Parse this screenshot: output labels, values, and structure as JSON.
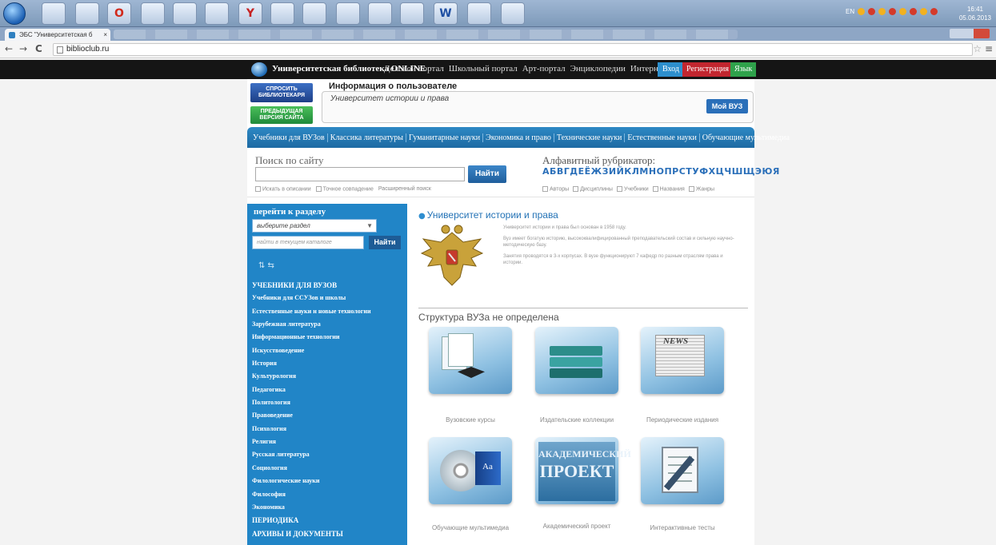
{
  "taskbar": {
    "icons": [
      "W",
      "O",
      "Y",
      "W"
    ],
    "tray_lang": "EN",
    "clock_time": "16:41",
    "clock_date": "05.06.2013"
  },
  "browser": {
    "tab_title": "ЭБС \"Университетская б",
    "tab_close": "×",
    "url": "biblioclub.ru",
    "back": "←",
    "forward": "→",
    "reload": "C",
    "star": "☆",
    "menu": "≡"
  },
  "site": {
    "title": "Университетская библиотека ONLINE",
    "top_nav": [
      "Деловой портал",
      "Школьный портал",
      "Арт-портал",
      "Энциклопедии",
      "Интернет-магазин"
    ],
    "login": "Вход",
    "register": "Регистрация",
    "lang": "Язык"
  },
  "header": {
    "ask_line1": "СПРОСИТЬ",
    "ask_line2": "БИБЛИОТЕКАРЯ",
    "prev_line1": "ПРЕДЫДУЩАЯ",
    "prev_line2": "ВЕРСИЯ САЙТА",
    "userinfo_title": "Информация о пользователе",
    "userinfo_name": "Университет истории и права",
    "myvuz": "Мой ВУЗ"
  },
  "categories": [
    "Учебники для ВУЗов",
    "Классика литературы",
    "Гуманитарные науки",
    "Экономика и право",
    "Технические науки",
    "Естественные науки",
    "Обучающие мультимедиа"
  ],
  "search": {
    "title": "Поиск по сайту",
    "button": "Найти",
    "options": [
      "Искать в описании",
      "Точное совпадение",
      "Расширенный поиск"
    ],
    "alpha_title": "Алфавитный рубрикатор:",
    "alphabet": "АБВГДЕЁЖЗИЙКЛМНОПРСТУФХЦЧШЩЭЮЯ",
    "alpha_options": [
      "Авторы",
      "Дисциплины",
      "Учебники",
      "Названия",
      "Жанры"
    ]
  },
  "sidebar": {
    "heading": "перейти к разделу",
    "select_value": "выберите раздел",
    "input_placeholder": "найти в текущем каталоге",
    "button": "Найти",
    "sort_icons": "⇅  ⇆",
    "items": [
      "УЧЕБНИКИ ДЛЯ ВУЗОВ",
      "Учебники для ССУЗов и школы",
      "Естественные науки и новые технологии",
      "Зарубежная литература",
      "Информационные технологии",
      "Искусствоведение",
      "История",
      "Культурология",
      "Педагогика",
      "Политология",
      "Правоведение",
      "Психология",
      "Религия",
      "Русская литература",
      "Социология",
      "Филологические науки",
      "Философия",
      "Экономика",
      "ПЕРИОДИКА",
      "АРХИВЫ И ДОКУМЕНТЫ"
    ]
  },
  "main": {
    "title": "Университет истории и права",
    "title_icon": "globe-icon",
    "desc": [
      "Университет истории и права был основан в 1958 году.",
      "Вуз имеет богатую историю, высококвалифицированный преподавательский состав и сильную научно-методическую базу.",
      "Занятия проводятся в 3-х корпусах. В вузе функционируют 7 кафедр по разным отраслям права и истории."
    ],
    "struct_title": "Структура ВУЗа не определена",
    "tiles": [
      "Вузовские курсы",
      "Издательские коллекции",
      "Периодические издания",
      "Обучающие мультимедиа",
      "Академический проект",
      "Интерактивные тесты"
    ],
    "news_text": "NEWS",
    "book_text": "Aa",
    "acad_line1": "АКАДЕМИЧЕСКИЙ",
    "acad_line2": "ПРОЕКТ"
  }
}
